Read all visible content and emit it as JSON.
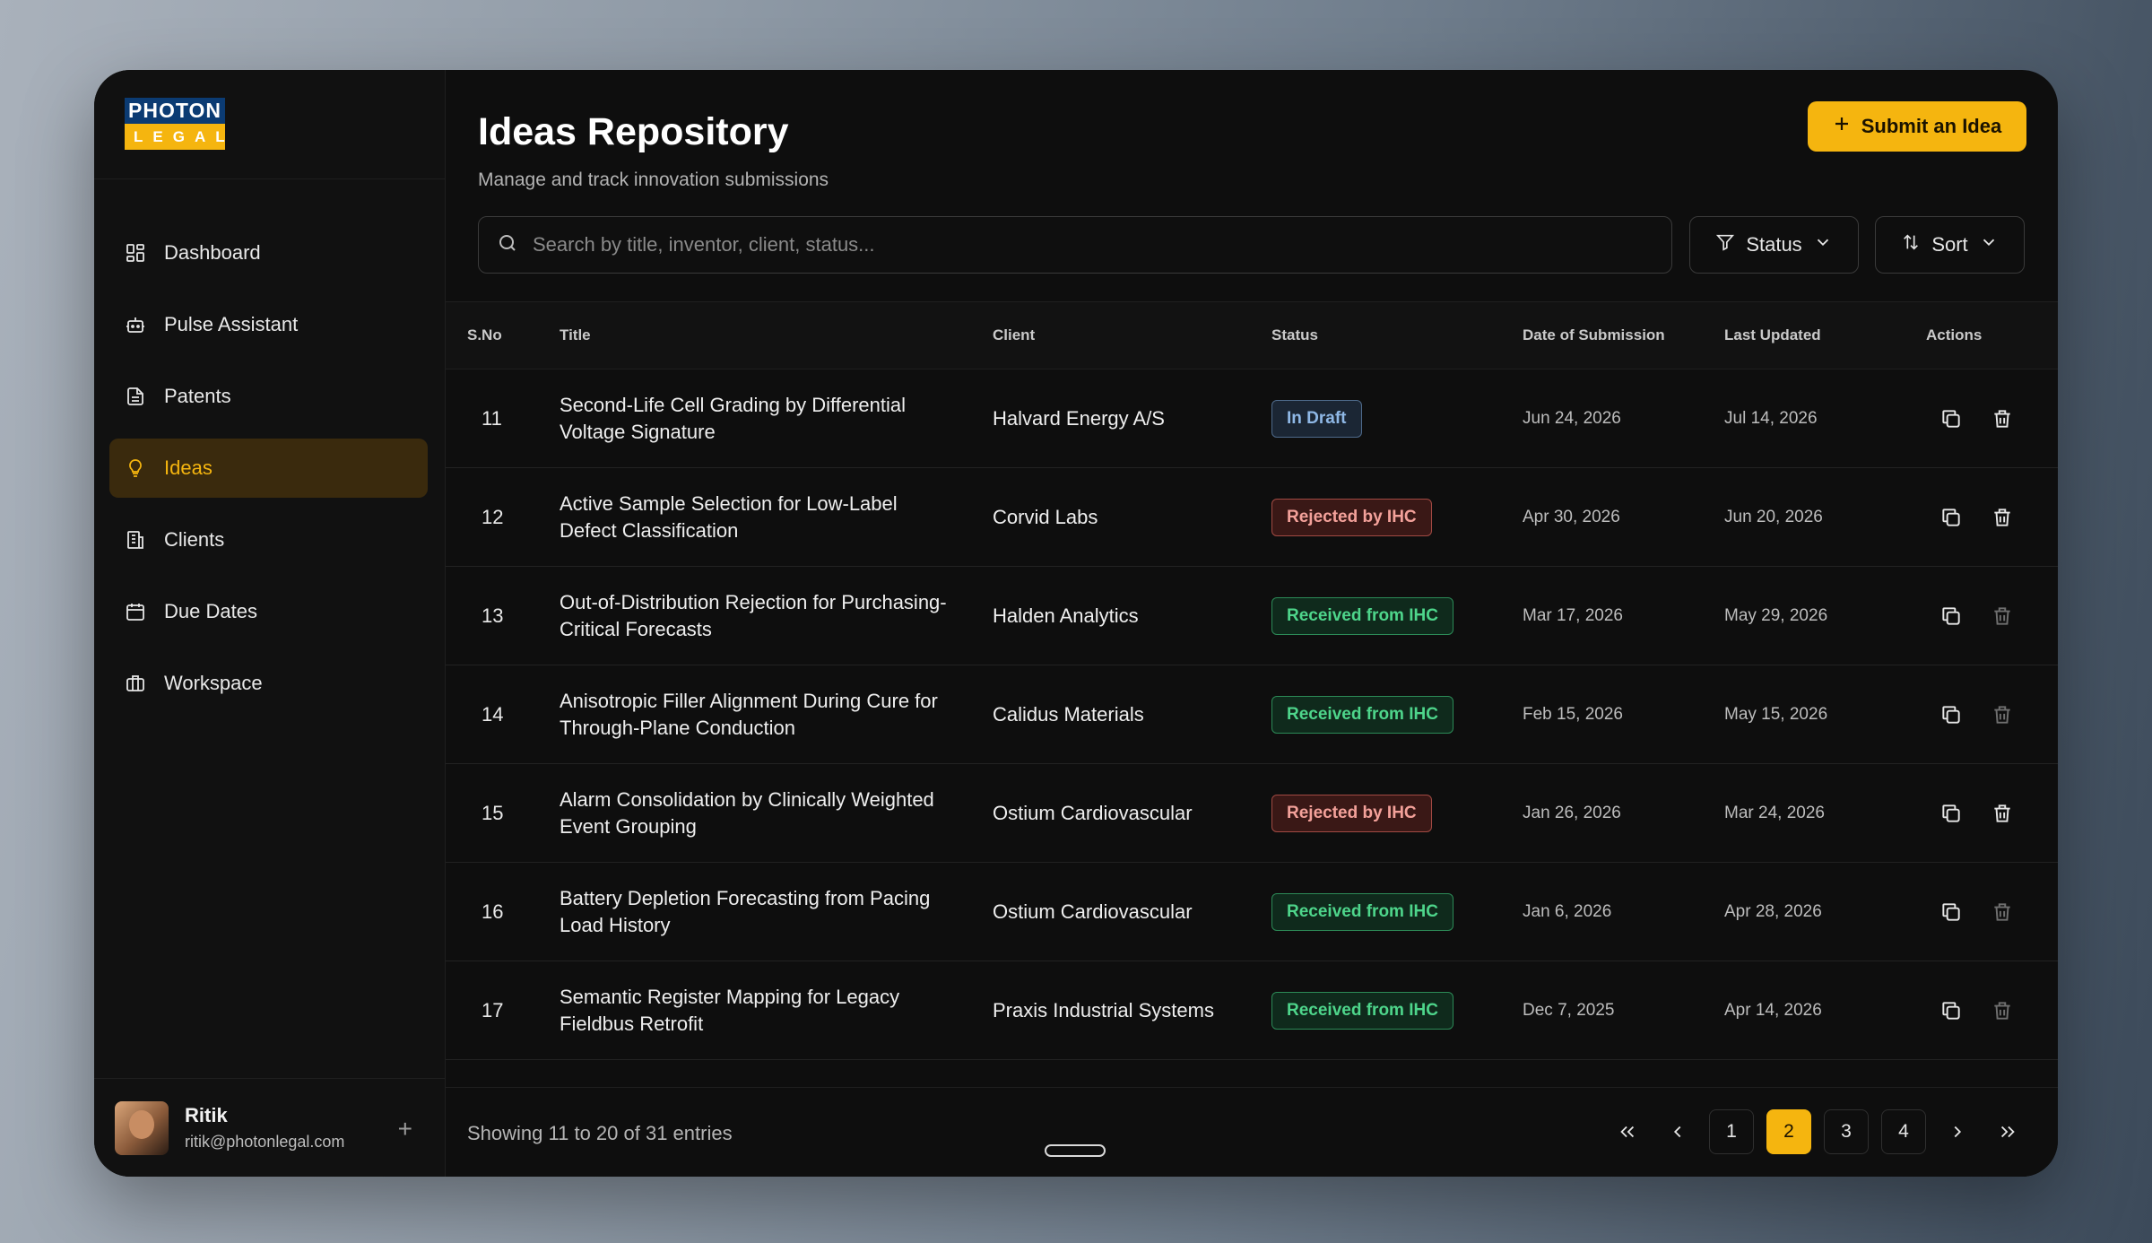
{
  "app": {
    "logo_top": "PHOTON",
    "logo_bottom": "LEGAL"
  },
  "colors": {
    "accent": "#f5b50f",
    "background": "#0e0e0e",
    "rejected": "#f3a19a",
    "received": "#4ed58b",
    "draft": "#8fb8e6"
  },
  "sidebar": {
    "items": [
      {
        "label": "Dashboard",
        "icon": "dashboard-icon"
      },
      {
        "label": "Pulse Assistant",
        "icon": "robot-icon"
      },
      {
        "label": "Patents",
        "icon": "document-icon"
      },
      {
        "label": "Ideas",
        "icon": "lightbulb-icon",
        "active": true
      },
      {
        "label": "Clients",
        "icon": "building-icon"
      },
      {
        "label": "Due Dates",
        "icon": "calendar-icon"
      },
      {
        "label": "Workspace",
        "icon": "briefcase-icon"
      }
    ],
    "user": {
      "name": "Ritik",
      "email": "ritik@photonlegal.com"
    }
  },
  "header": {
    "title": "Ideas Repository",
    "subtitle": "Manage and track innovation submissions",
    "submit_label": "Submit an Idea"
  },
  "search": {
    "placeholder": "Search by title, inventor, client, status...",
    "value": ""
  },
  "filters": {
    "status_label": "Status",
    "sort_label": "Sort"
  },
  "table": {
    "columns": [
      "S.No",
      "Title",
      "Client",
      "Status",
      "Date of Submission",
      "Last Updated",
      "Actions"
    ],
    "rows": [
      {
        "sno": "11",
        "title": "Second-Life Cell Grading by Differential Voltage Signature",
        "client": "Halvard Energy A/S",
        "status": "In Draft",
        "status_type": "draft",
        "submitted": "Jun 24, 2026",
        "updated": "Jul 14, 2026",
        "delete_enabled": true
      },
      {
        "sno": "12",
        "title": "Active Sample Selection for Low-Label Defect Classification",
        "client": "Corvid Labs",
        "status": "Rejected by IHC",
        "status_type": "rejected",
        "submitted": "Apr 30, 2026",
        "updated": "Jun 20, 2026",
        "delete_enabled": true
      },
      {
        "sno": "13",
        "title": "Out-of-Distribution Rejection for Purchasing-Critical Forecasts",
        "client": "Halden Analytics",
        "status": "Received from IHC",
        "status_type": "received",
        "submitted": "Mar 17, 2026",
        "updated": "May 29, 2026",
        "delete_enabled": false
      },
      {
        "sno": "14",
        "title": "Anisotropic Filler Alignment During Cure for Through-Plane Conduction",
        "client": "Calidus Materials",
        "status": "Received from IHC",
        "status_type": "received",
        "submitted": "Feb 15, 2026",
        "updated": "May 15, 2026",
        "delete_enabled": false
      },
      {
        "sno": "15",
        "title": "Alarm Consolidation by Clinically Weighted Event Grouping",
        "client": "Ostium Cardiovascular",
        "status": "Rejected by IHC",
        "status_type": "rejected",
        "submitted": "Jan 26, 2026",
        "updated": "Mar 24, 2026",
        "delete_enabled": true
      },
      {
        "sno": "16",
        "title": "Battery Depletion Forecasting from Pacing Load History",
        "client": "Ostium Cardiovascular",
        "status": "Received from IHC",
        "status_type": "received",
        "submitted": "Jan 6, 2026",
        "updated": "Apr 28, 2026",
        "delete_enabled": false
      },
      {
        "sno": "17",
        "title": "Semantic Register Mapping for Legacy Fieldbus Retrofit",
        "client": "Praxis Industrial Systems",
        "status": "Received from IHC",
        "status_type": "received",
        "submitted": "Dec 7, 2025",
        "updated": "Apr 14, 2026",
        "delete_enabled": false
      }
    ]
  },
  "footer": {
    "showing": "Showing 11 to 20 of 31 entries",
    "pages": [
      "1",
      "2",
      "3",
      "4"
    ],
    "current_page": "2"
  }
}
